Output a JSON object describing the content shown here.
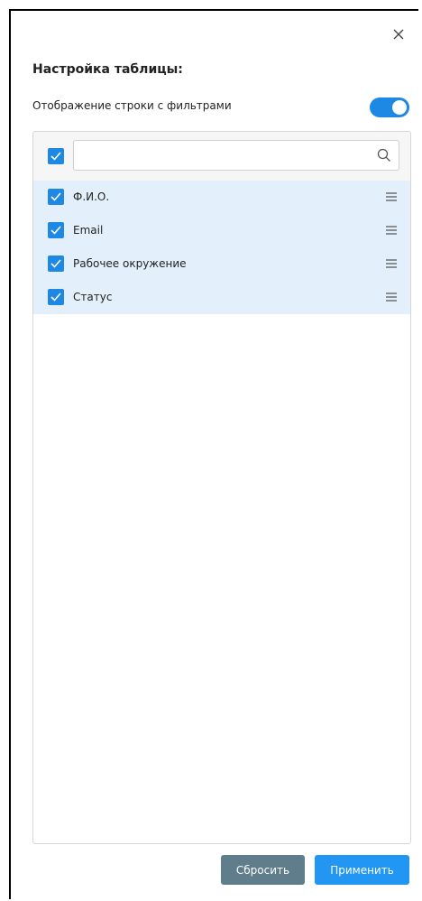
{
  "dialog": {
    "title": "Настройка таблицы:",
    "filter_row_label": "Отображение строки с фильтрами",
    "filter_row_enabled": true
  },
  "search": {
    "value": "",
    "placeholder": ""
  },
  "columns": [
    {
      "label": "Ф.И.О.",
      "checked": true
    },
    {
      "label": "Email",
      "checked": true
    },
    {
      "label": "Рабочее окружение",
      "checked": true
    },
    {
      "label": "Статус",
      "checked": true
    }
  ],
  "buttons": {
    "reset_label": "Сбросить",
    "apply_label": "Применить"
  },
  "colors": {
    "accent": "#1e88e5",
    "row_selected": "#e3f0fc",
    "reset_button": "#607d8b",
    "apply_button": "#2196f3"
  },
  "icons": {
    "close": "close-icon",
    "search": "search-icon",
    "drag": "drag-handle-icon",
    "check": "check-icon"
  }
}
